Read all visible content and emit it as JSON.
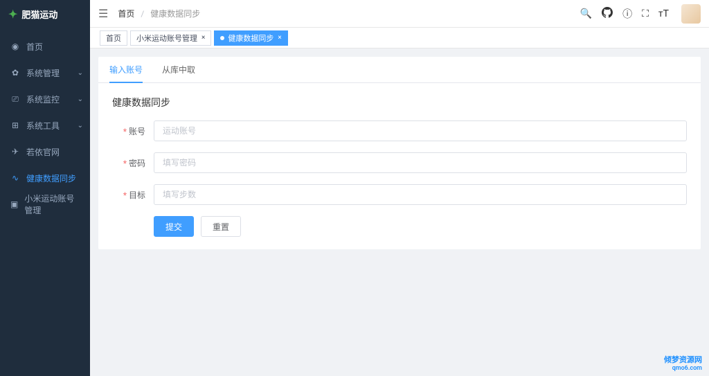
{
  "app": {
    "name": "肥猫运动"
  },
  "sidebar": {
    "items": [
      {
        "label": "首页",
        "icon": "⌂"
      },
      {
        "label": "系统管理",
        "icon": "⚙",
        "expandable": true
      },
      {
        "label": "系统监控",
        "icon": "⎚",
        "expandable": true
      },
      {
        "label": "系统工具",
        "icon": "⊞",
        "expandable": true
      },
      {
        "label": "若依官网",
        "icon": "✈"
      },
      {
        "label": "健康数据同步",
        "icon": "✓",
        "active": true
      },
      {
        "label": "小米运动账号管理",
        "icon": "▣"
      }
    ]
  },
  "breadcrumb": {
    "home": "首页",
    "current": "健康数据同步"
  },
  "tabs": [
    {
      "label": "首页"
    },
    {
      "label": "小米运动账号管理",
      "closable": true
    },
    {
      "label": "健康数据同步",
      "closable": true,
      "active": true
    }
  ],
  "innerTabs": [
    {
      "label": "输入账号",
      "active": true
    },
    {
      "label": "从库中取"
    }
  ],
  "form": {
    "title": "健康数据同步",
    "fields": {
      "account": {
        "label": "账号",
        "placeholder": "运动账号"
      },
      "password": {
        "label": "密码",
        "placeholder": "填写密码"
      },
      "target": {
        "label": "目标",
        "placeholder": "填写步数"
      }
    },
    "submit": "提交",
    "reset": "重置"
  },
  "watermark": {
    "line1": "倾梦资源网",
    "line2": "qmo6.com"
  }
}
